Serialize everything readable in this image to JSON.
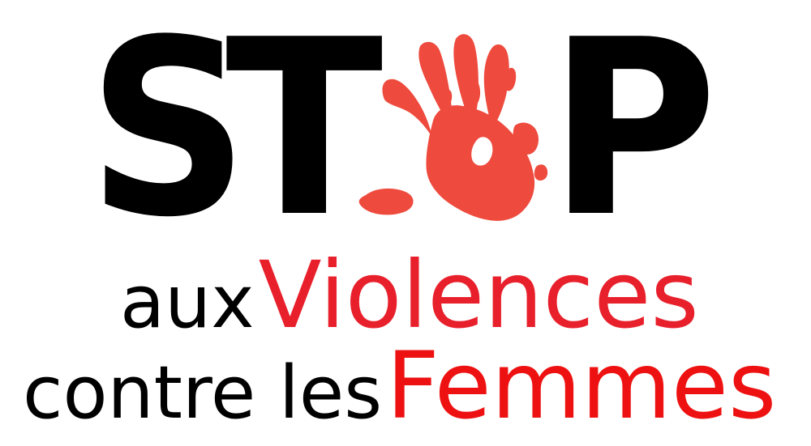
{
  "headline": {
    "letters": [
      "S",
      "T",
      "P"
    ],
    "hand_icon": "red-handprint-icon"
  },
  "line2": {
    "word1": "aux",
    "word2": "Violences"
  },
  "line3": {
    "word1": "contre les",
    "word2": "Femmes"
  },
  "colors": {
    "text_black": "#000000",
    "red_violences": "#e8202c",
    "red_femmes": "#ee1111",
    "hand_red": "#ee4a3d",
    "background": "#ffffff"
  }
}
